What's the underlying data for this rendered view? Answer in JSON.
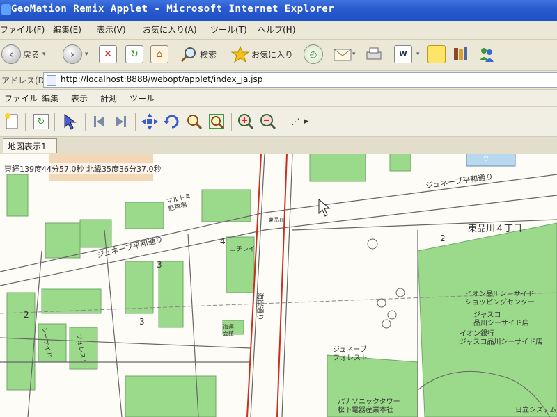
{
  "window": {
    "title": "GeoMation Remix Applet - Microsoft Internet Explorer"
  },
  "menu": [
    "ファイル(F)",
    "編集(E)",
    "表示(V)",
    "お気に入り(A)",
    "ツール(T)",
    "ヘルプ(H)"
  ],
  "toolbar": {
    "back_label": "戻る",
    "search_label": "検索",
    "favorites_label": "お気に入り"
  },
  "address": {
    "label": "アドレス(D)",
    "url": "http://localhost:8888/webopt/applet/index_ja.jsp"
  },
  "applet": {
    "menu": [
      "ファイル",
      "編集",
      "表示",
      "計測",
      "ツール"
    ],
    "tab_label": "地図表示1",
    "coords": "東経139度44分57.0秒 北緯35度36分37.0秒"
  },
  "map": {
    "labels": {
      "street_geneve_1": "ジュネーブ平和通り",
      "street_geneve_2": "ジュネーブ平和通り",
      "district": "東品川４丁目",
      "aeon_center": "イオン品川シーサイド\nショッピングセンター",
      "jusco": "ジャスコ\n品川シーサイド店",
      "aeon_bank": "イオン銀行\nジャスコ品川シーサイド店",
      "geneve_forest": "ジュネーブ\nフォレスト",
      "panasonic": "パナソニックタワー\n松下電器産業本社",
      "kaigan_dori": "海岸通り",
      "hitachi": "日立システム",
      "marutoh": "マルトミ\n駐車場",
      "seaside": "シーサイド",
      "forest": "フォレスト",
      "nichirei": "ニチレイ",
      "tosho": "東品川",
      "kaiun": "海運\n会館",
      "vtag": "ワ",
      "num2a": "2",
      "num2b": "2",
      "num3a": "3",
      "num3b": "3",
      "num4": "4"
    }
  }
}
